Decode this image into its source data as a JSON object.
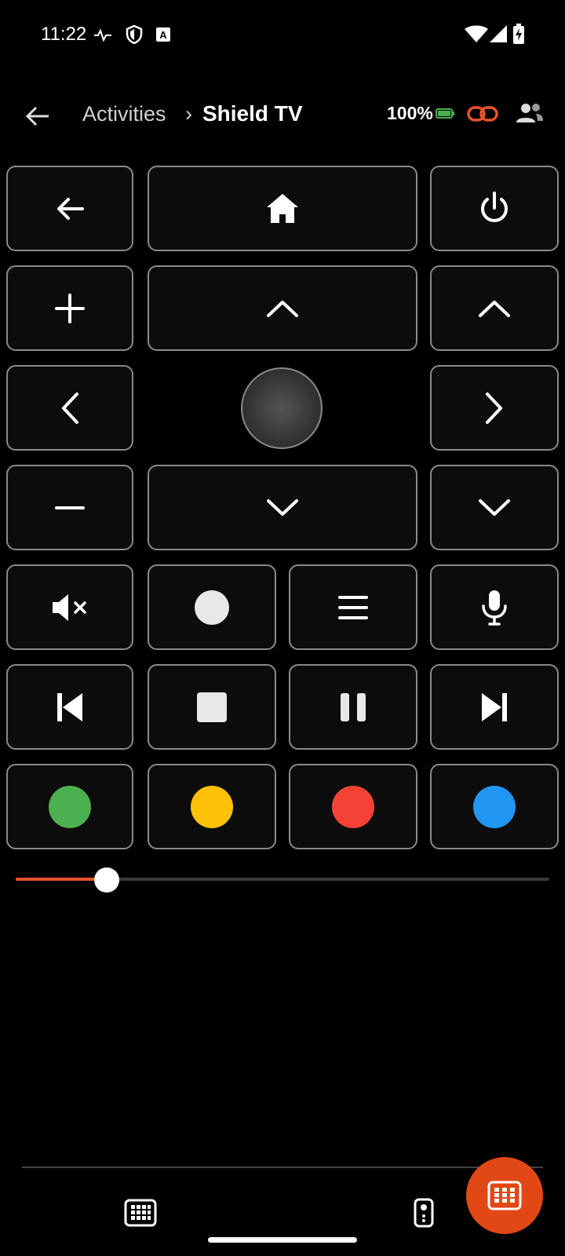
{
  "status_bar": {
    "time": "11:22"
  },
  "header": {
    "breadcrumb_parent": "Activities",
    "breadcrumb_sep": "›",
    "breadcrumb_current": "Shield TV",
    "battery": "100%"
  },
  "colors": {
    "accent": "#e8532a",
    "fab": "#e24815",
    "green": "#4caf50",
    "yellow": "#ffc107",
    "red": "#f44336",
    "blue": "#2196f3",
    "button_border": "#8a8a8a",
    "button_bg": "#0c0c0c"
  },
  "remote": {
    "buttons": [
      "back-arrow-icon",
      "home-icon",
      "power-icon",
      "plus-icon",
      "up-chevron-icon",
      "channel-up-icon",
      "left-chevron-icon",
      "touchpad",
      "right-chevron-icon",
      "minus-icon",
      "down-chevron-icon",
      "channel-down-icon",
      "mute-icon",
      "record-icon",
      "menu-icon",
      "microphone-icon",
      "skip-previous-icon",
      "stop-icon",
      "pause-icon",
      "skip-next-icon",
      "green-dot",
      "yellow-dot",
      "red-dot",
      "blue-dot"
    ]
  },
  "slider": {
    "value": 0.17
  },
  "bottom_nav": {
    "items": [
      "keypad-icon",
      "remote-icon"
    ],
    "fab": "grid-icon"
  }
}
